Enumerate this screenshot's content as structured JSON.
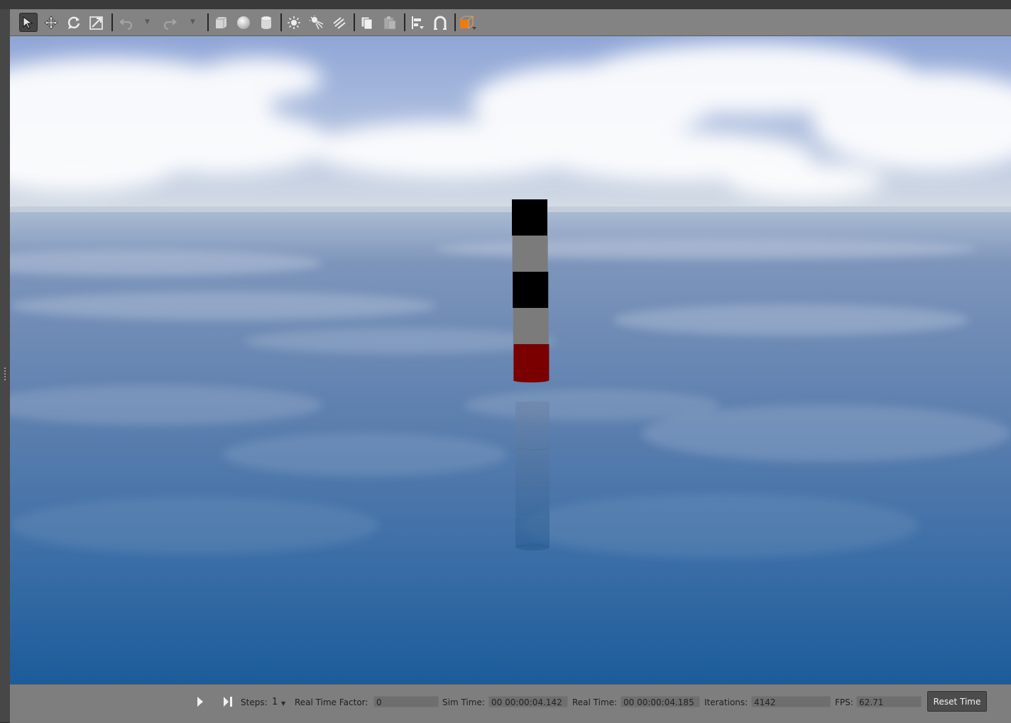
{
  "toolbar": {
    "tools": [
      {
        "icon": "select-arrow-icon",
        "active": true
      },
      {
        "icon": "translate-icon"
      },
      {
        "icon": "rotate-icon"
      },
      {
        "icon": "scale-icon"
      },
      {
        "icon": "undo-icon"
      },
      {
        "icon": "redo-icon"
      },
      {
        "icon": "box-shape-icon"
      },
      {
        "icon": "sphere-shape-icon"
      },
      {
        "icon": "cylinder-shape-icon"
      },
      {
        "icon": "point-light-icon"
      },
      {
        "icon": "spot-light-icon"
      },
      {
        "icon": "directional-light-icon"
      },
      {
        "icon": "copy-icon"
      },
      {
        "icon": "paste-icon"
      },
      {
        "icon": "align-icon"
      },
      {
        "icon": "snap-magnet-icon"
      },
      {
        "icon": "view-angle-icon"
      }
    ]
  },
  "scene": {
    "object": "striped-buoy-pole",
    "stripe_colors": [
      "#000000",
      "#7b7b7b",
      "#000000",
      "#7b7b7b",
      "#7a0000"
    ],
    "sky_color": "#a9b8d8",
    "water_color": "#1c5b97"
  },
  "bottom": {
    "steps_label": "Steps:",
    "steps_value": "1",
    "rtf_label": "Real Time Factor:",
    "rtf_value": "0",
    "sim_time_label": "Sim Time:",
    "sim_time_value": "00 00:00:04.142",
    "real_time_label": "Real Time:",
    "real_time_value": "00 00:00:04.185",
    "iterations_label": "Iterations:",
    "iterations_value": "4142",
    "fps_label": "FPS:",
    "fps_value": "62.71",
    "reset_label": "Reset Time"
  }
}
